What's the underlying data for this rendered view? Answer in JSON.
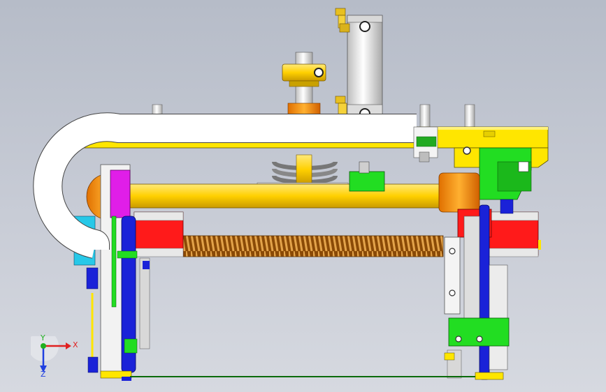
{
  "viewport": {
    "axis_triad": {
      "x_label": "X",
      "y_label": "Y",
      "z_label": "Z"
    }
  },
  "colors": {
    "background_top": "#b6bcc8",
    "background_bottom": "#d6d9e0",
    "frame_yellow": "#ffe600",
    "cable_chain": "#ffffff",
    "shaft_gold": "#ffd400",
    "spring_brown": "#b8660c",
    "block_red": "#ff1a1a",
    "bracket_magenta": "#e01ee8",
    "bracket_green": "#22dd22",
    "plate_blue": "#1a22d8",
    "cylinder_gray": "#e6e6e6",
    "pulley_orange": "#ff8a10",
    "axis_x": "#e02020",
    "axis_y": "#20b020",
    "axis_z": "#2040e0"
  }
}
